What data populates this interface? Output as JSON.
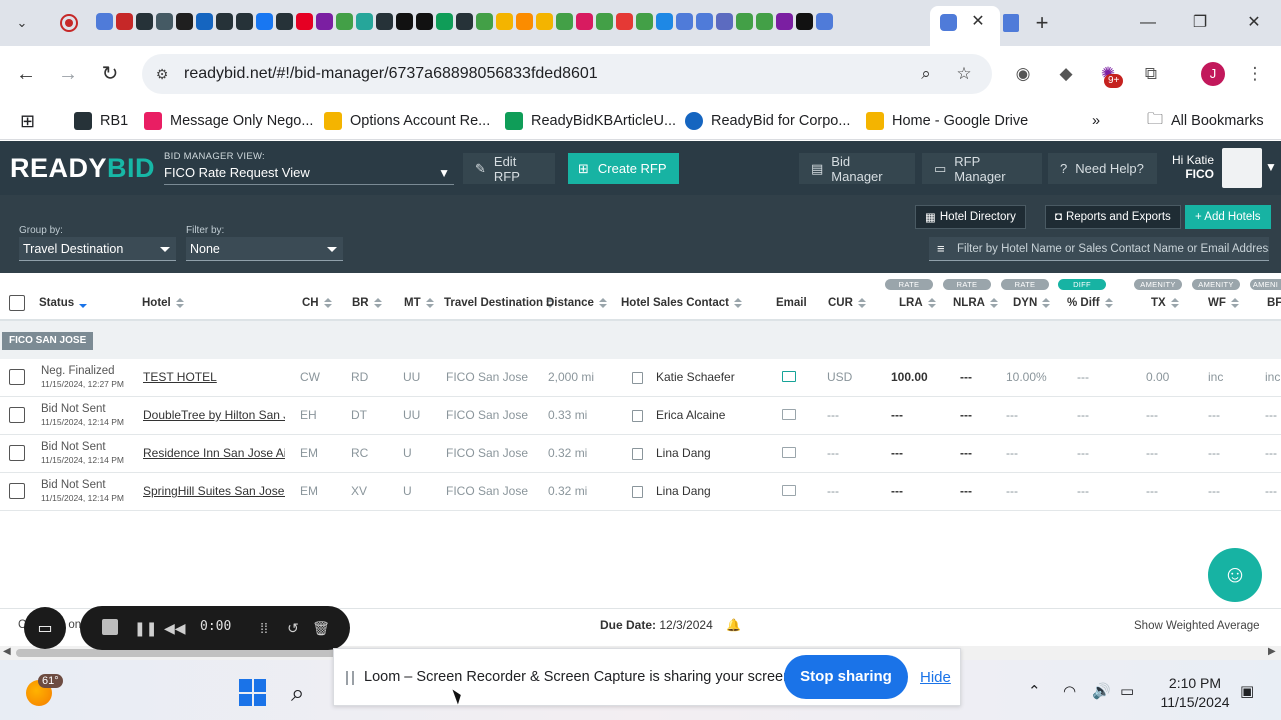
{
  "browser": {
    "url": "readybid.net/#!/bid-manager/6737a68898056833fded8601",
    "profile_initial": "J",
    "extensions_badge": "9+",
    "bookmarks": [
      {
        "label": "RB1",
        "color": "#263238"
      },
      {
        "label": "Message Only Nego...",
        "color": "#e91e63"
      },
      {
        "label": "Options Account Re...",
        "color": "#f4b400"
      },
      {
        "label": "ReadyBidKBArticleU...",
        "color": "#0f9d58"
      },
      {
        "label": "ReadyBid for Corpo...",
        "color": "#1565c0"
      },
      {
        "label": "Home - Google Drive",
        "color": "#f4b400"
      }
    ],
    "all_bookmarks": "All Bookmarks",
    "tab_colors": [
      "#4f7bd9",
      "#c62828",
      "#263238",
      "#455a64",
      "#1f1f1f",
      "#1565c0",
      "#263238",
      "#263238",
      "#1877f2",
      "#263238",
      "#e60023",
      "#7b1fa2",
      "#43a047",
      "#26a69a",
      "#263238",
      "#111",
      "#111",
      "#0f9d58",
      "#263238",
      "#43a047",
      "#f4b400",
      "#fb8c00",
      "#f4b400",
      "#43a047",
      "#d81b60",
      "#43a047",
      "#e53935",
      "#43a047",
      "#1e88e5",
      "#4f7bd9",
      "#4f7bd9",
      "#5c6bc0",
      "#43a047",
      "#43a047",
      "#7b1fa2",
      "#111",
      "#4f7bd9"
    ]
  },
  "app": {
    "logo_ready": "READY",
    "logo_bid": "BID",
    "view_label": "BID MANAGER VIEW:",
    "view_value": "FICO Rate Request View",
    "edit_rfp": "Edit RFP",
    "create_rfp": "Create RFP",
    "bid_manager": "Bid Manager",
    "rfp_manager": "RFP Manager",
    "need_help": "Need Help?",
    "hi": "Hi Katie",
    "company": "FICO"
  },
  "filters": {
    "group_label": "Group by:",
    "group_value": "Travel Destination",
    "filter_label": "Filter by:",
    "filter_value": "None",
    "hotel_directory": "Hotel Directory",
    "reports": "Reports and Exports",
    "add_hotels": "+ Add Hotels",
    "search_placeholder": "Filter by Hotel Name or Sales Contact Name or Email Address"
  },
  "columns": {
    "status": "Status",
    "hotel": "Hotel",
    "ch": "CH",
    "br": "BR",
    "mt": "MT",
    "dest": "Travel Destination",
    "distance": "Distance",
    "contact": "Hotel Sales Contact",
    "email": "Email",
    "cur": "CUR",
    "lra": "LRA",
    "nlra": "NLRA",
    "dyn": "DYN",
    "diff": "% Diff",
    "tx": "TX",
    "wf": "WF",
    "bf": "BF",
    "pill_rate": "RATE",
    "pill_diff": "DIFF",
    "pill_amenity": "AMENITY",
    "pill_amenity_cut": "AMENI"
  },
  "group": "FICO SAN JOSE",
  "rows": [
    {
      "status": "Neg. Finalized",
      "date": "11/15/2024, 12:27 PM",
      "hotel": "TEST HOTEL",
      "ch": "CW",
      "br": "RD",
      "mt": "UU",
      "dest": "FICO San Jose",
      "distance": "2,000 mi",
      "contact": "Katie Schaefer",
      "cur": "USD",
      "lra": "100.00",
      "nlra": "---",
      "dyn": "10.00%",
      "diff": "---",
      "tx": "0.00",
      "wf": "inc",
      "bf": "inc"
    },
    {
      "status": "Bid Not Sent",
      "date": "11/15/2024, 12:14 PM",
      "hotel": "DoubleTree by Hilton San Jose",
      "ch": "EH",
      "br": "DT",
      "mt": "UU",
      "dest": "FICO San Jose",
      "distance": "0.33 mi",
      "contact": "Erica Alcaine",
      "cur": "---",
      "lra": "---",
      "nlra": "---",
      "dyn": "---",
      "diff": "---",
      "tx": "---",
      "wf": "---",
      "bf": "---"
    },
    {
      "status": "Bid Not Sent",
      "date": "11/15/2024, 12:14 PM",
      "hotel": "Residence Inn San Jose Airport",
      "ch": "EM",
      "br": "RC",
      "mt": "U",
      "dest": "FICO San Jose",
      "distance": "0.32 mi",
      "contact": "Lina Dang",
      "cur": "---",
      "lra": "---",
      "nlra": "---",
      "dyn": "---",
      "diff": "---",
      "tx": "---",
      "wf": "---",
      "bf": "---"
    },
    {
      "status": "Bid Not Sent",
      "date": "11/15/2024, 12:14 PM",
      "hotel": "SpringHill Suites San Jose Airport",
      "ch": "EM",
      "br": "XV",
      "mt": "U",
      "dest": "FICO San Jose",
      "distance": "0.32 mi",
      "contact": "Lina Dang",
      "cur": "---",
      "lra": "---",
      "nlra": "---",
      "dyn": "---",
      "diff": "---",
      "tx": "---",
      "wf": "---",
      "bf": "---"
    }
  ],
  "footer": {
    "left": "C",
    "left_2": "on",
    "due_label": "Due Date:",
    "due_value": "12/3/2024",
    "weighted": "Show Weighted Average"
  },
  "loom": {
    "time": "0:00",
    "share_text": "Loom – Screen Recorder & Screen Capture is sharing your screen.",
    "stop": "Stop sharing",
    "hide": "Hide"
  },
  "taskbar": {
    "temp": "61°",
    "time": "2:10 PM",
    "date": "11/15/2024"
  }
}
